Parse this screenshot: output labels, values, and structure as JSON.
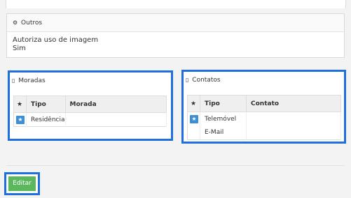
{
  "outros": {
    "icon": "gears-icon",
    "title": "Outros",
    "field_label": "Autoriza uso de imagem",
    "field_value": "Sim"
  },
  "moradas": {
    "icon": "building-icon",
    "title": "Moradas",
    "columns": [
      "★",
      "Tipo",
      "Morada"
    ],
    "rows": [
      {
        "starred": true,
        "tipo": "Residência",
        "morada": ""
      }
    ]
  },
  "contatos": {
    "icon": "phone-icon",
    "title": "Contatos",
    "columns": [
      "★",
      "Tipo",
      "Contato"
    ],
    "rows": [
      {
        "starred": true,
        "tipo": "Telemóvel",
        "contato": ""
      },
      {
        "starred": false,
        "tipo": "E-Mail",
        "contato": ""
      }
    ]
  },
  "actions": {
    "edit_label": "Editar"
  },
  "colors": {
    "highlight": "#1f6fe0",
    "star_badge": "#3a8fd6",
    "edit_button": "#5cb85c"
  }
}
